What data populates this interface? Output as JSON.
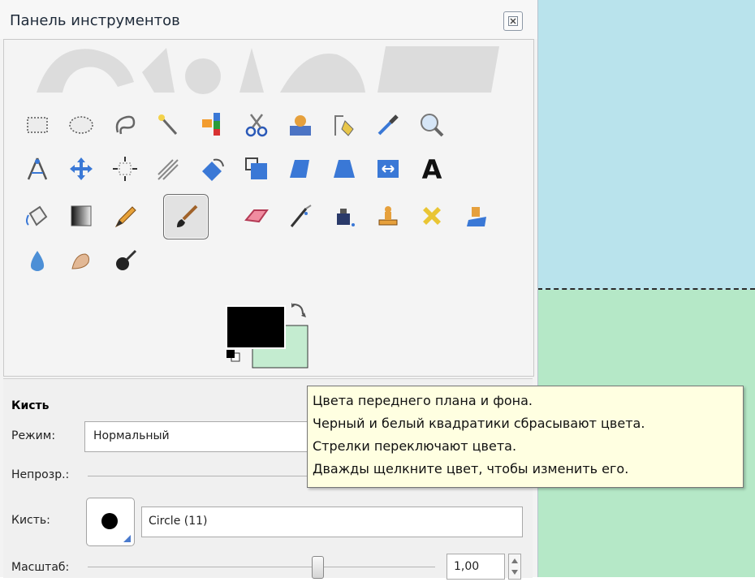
{
  "window": {
    "title": "Панель инструментов",
    "close_icon": "close-icon"
  },
  "tools": [
    {
      "name": "rect-select-tool-icon"
    },
    {
      "name": "ellipse-select-tool-icon"
    },
    {
      "name": "free-select-tool-icon"
    },
    {
      "name": "fuzzy-select-tool-icon"
    },
    {
      "name": "select-by-color-tool-icon"
    },
    {
      "name": "scissors-select-tool-icon"
    },
    {
      "name": "foreground-select-tool-icon"
    },
    {
      "name": "paths-tool-icon"
    },
    {
      "name": "color-picker-tool-icon"
    },
    {
      "name": "zoom-tool-icon"
    },
    {
      "name": "measure-tool-icon"
    },
    {
      "name": "move-tool-icon"
    },
    {
      "name": "align-tool-icon"
    },
    {
      "name": "crop-tool-icon"
    },
    {
      "name": "rotate-tool-icon"
    },
    {
      "name": "scale-tool-icon"
    },
    {
      "name": "shear-tool-icon"
    },
    {
      "name": "perspective-tool-icon"
    },
    {
      "name": "flip-tool-icon"
    },
    {
      "name": "text-tool-icon",
      "glyph": "A"
    },
    {
      "name": "bucket-fill-tool-icon"
    },
    {
      "name": "blend-tool-icon"
    },
    {
      "name": "pencil-tool-icon"
    },
    {
      "name": "paintbrush-tool-icon",
      "active": true
    },
    {
      "name": "eraser-tool-icon"
    },
    {
      "name": "airbrush-tool-icon"
    },
    {
      "name": "ink-tool-icon"
    },
    {
      "name": "clone-tool-icon"
    },
    {
      "name": "heal-tool-icon"
    },
    {
      "name": "perspective-clone-tool-icon"
    },
    {
      "name": "blur-tool-icon"
    },
    {
      "name": "smudge-tool-icon"
    },
    {
      "name": "dodge-burn-tool-icon"
    }
  ],
  "colors": {
    "foreground": "#000000",
    "background": "#c4ecd0"
  },
  "tool_options": {
    "title": "Кисть",
    "mode_label": "Режим:",
    "mode_value": "Нормальный",
    "opacity_label": "Непрозр.:",
    "brush_label": "Кисть:",
    "brush_value": "Circle (11)",
    "scale_label": "Масштаб:",
    "scale_value": "1,00",
    "scale_fraction": 0.54
  },
  "tooltip": {
    "lines": [
      "Цвета переднего плана и фона.",
      "Черный и белый квадратики сбрасывают цвета.",
      "Стрелки переключают цвета.",
      "Дважды щелкните цвет, чтобы изменить его."
    ]
  },
  "canvas": {
    "top_color": "#b9e3ec",
    "bottom_color": "#b5e8c7"
  }
}
